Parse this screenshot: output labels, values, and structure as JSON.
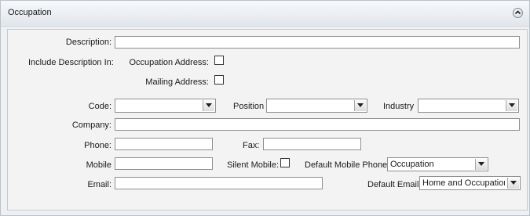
{
  "panel": {
    "title": "Occupation"
  },
  "form": {
    "description": {
      "label": "Description:",
      "value": ""
    },
    "include_label": "Include Description In:",
    "occupation_address": {
      "label": "Occupation Address:",
      "checked": false
    },
    "mailing_address": {
      "label": "Mailing Address:",
      "checked": false
    },
    "code": {
      "label": "Code:",
      "value": ""
    },
    "position": {
      "label": "Position",
      "value": ""
    },
    "industry": {
      "label": "Industry",
      "value": ""
    },
    "company": {
      "label": "Company:",
      "value": ""
    },
    "phone": {
      "label": "Phone:",
      "value": ""
    },
    "fax": {
      "label": "Fax:",
      "value": ""
    },
    "mobile": {
      "label": "Mobile",
      "value": ""
    },
    "silent_mobile": {
      "label": "Silent Mobile:",
      "checked": false
    },
    "default_mobile_phone": {
      "label": "Default Mobile Phone",
      "value": "Occupation"
    },
    "email": {
      "label": "Email:",
      "value": ""
    },
    "default_email": {
      "label": "Default Email",
      "value": "Home and Occupation"
    }
  },
  "icons": {
    "collapse": "chevron-up-circle-icon",
    "dropdown": "triangle-down-icon"
  }
}
